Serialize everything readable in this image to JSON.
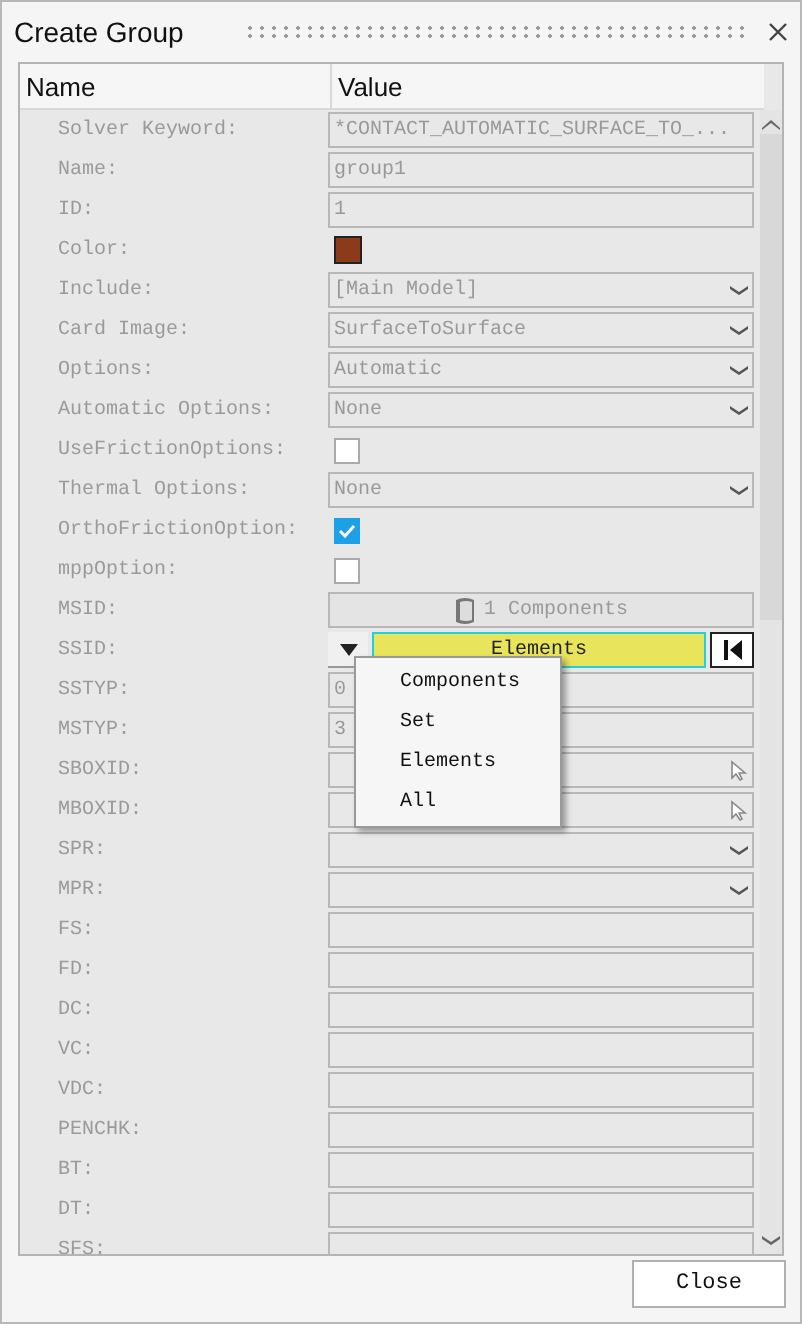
{
  "window": {
    "title": "Create Group"
  },
  "table": {
    "columns": [
      "Name",
      "Value"
    ],
    "rows": [
      {
        "label": "Solver Keyword:",
        "kind": "text",
        "value": "*CONTACT_AUTOMATIC_SURFACE_TO_..."
      },
      {
        "label": "Name:",
        "kind": "text",
        "value": "group1"
      },
      {
        "label": "ID:",
        "kind": "text",
        "value": "1"
      },
      {
        "label": "Color:",
        "kind": "color",
        "color": "#8b3a1a"
      },
      {
        "label": "Include:",
        "kind": "select",
        "value": "[Main Model]"
      },
      {
        "label": "Card Image:",
        "kind": "select",
        "value": "SurfaceToSurface"
      },
      {
        "label": "Options:",
        "kind": "select",
        "value": "Automatic"
      },
      {
        "label": "Automatic Options:",
        "kind": "select",
        "value": "None"
      },
      {
        "label": "UseFrictionOptions:",
        "kind": "checkbox",
        "checked": false
      },
      {
        "label": "Thermal Options:",
        "kind": "select",
        "value": "None"
      },
      {
        "label": "OrthoFrictionOption:",
        "kind": "checkbox",
        "checked": true
      },
      {
        "label": "mppOption:",
        "kind": "checkbox",
        "checked": false
      },
      {
        "label": "MSID:",
        "kind": "entity",
        "value": "1 Components"
      },
      {
        "label": "SSID:",
        "kind": "selector",
        "value": "Elements"
      },
      {
        "label": "SSTYP:",
        "kind": "text",
        "value": "0"
      },
      {
        "label": "MSTYP:",
        "kind": "text",
        "value": "3"
      },
      {
        "label": "SBOXID:",
        "kind": "picker"
      },
      {
        "label": "MBOXID:",
        "kind": "picker"
      },
      {
        "label": "SPR:",
        "kind": "select"
      },
      {
        "label": "MPR:",
        "kind": "select"
      },
      {
        "label": "FS:",
        "kind": "text"
      },
      {
        "label": "FD:",
        "kind": "text"
      },
      {
        "label": "DC:",
        "kind": "text"
      },
      {
        "label": "VC:",
        "kind": "text"
      },
      {
        "label": "VDC:",
        "kind": "text"
      },
      {
        "label": "PENCHK:",
        "kind": "text"
      },
      {
        "label": "BT:",
        "kind": "text"
      },
      {
        "label": "DT:",
        "kind": "text"
      },
      {
        "label": "SFS:",
        "kind": "text"
      }
    ]
  },
  "dropdown_menu": {
    "items": [
      "Components",
      "Set",
      "Elements",
      "All"
    ]
  },
  "buttons": [
    "Close"
  ]
}
